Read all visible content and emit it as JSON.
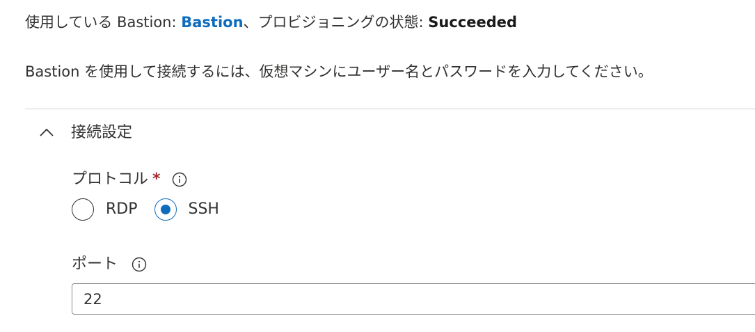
{
  "status": {
    "prefix": "使用している Bastion: ",
    "bastion_link": "Bastion",
    "middle": "、プロビジョニングの状態: ",
    "state": "Succeeded"
  },
  "intro_text": "Bastion を使用して接続するには、仮想マシンにユーザー名とパスワードを入力してください。",
  "connection_settings": {
    "title": "接続設定",
    "expanded": true,
    "chevron_icon": "chevron-up-icon",
    "protocol": {
      "label": "プロトコル",
      "required_mark": "*",
      "info_icon": "info-icon",
      "options": [
        {
          "label": "RDP",
          "checked": false
        },
        {
          "label": "SSH",
          "checked": true
        }
      ]
    },
    "port": {
      "label": "ポート",
      "info_icon": "info-icon",
      "value": "22"
    }
  },
  "colors": {
    "accent": "#0f6cbd",
    "required": "#a4262c",
    "text": "#323130",
    "border": "#8a8886",
    "divider": "#d1d1d1"
  }
}
